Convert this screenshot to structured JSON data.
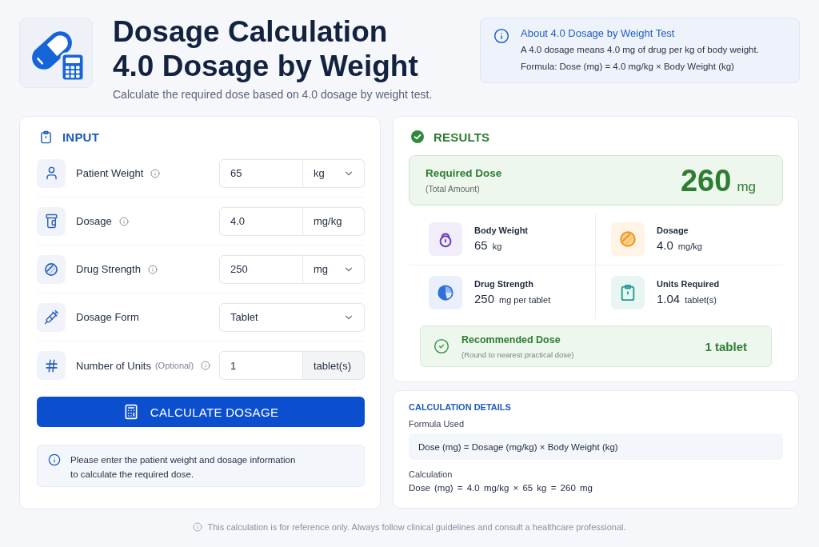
{
  "header": {
    "title_lines": [
      "Dosage Calculation",
      "4.0 Dosage by Weight"
    ],
    "subtitle": "Calculate the required dose based on 4.0 dosage by weight test."
  },
  "about": {
    "title": "About 4.0 Dosage by Weight Test",
    "lines": [
      "A 4.0 dosage means 4.0 mg of drug per kg of body weight.",
      "Formula: Dose (mg) = 4.0 mg/kg × Body Weight (kg)"
    ]
  },
  "input_panel": {
    "title": "INPUT",
    "fields": [
      {
        "label": "Patient Weight",
        "info": true,
        "kind": "number_unit",
        "value": "65",
        "unit": "kg",
        "unit_menu": true
      },
      {
        "label": "Dosage",
        "info": true,
        "kind": "number_unit",
        "value": "4.0",
        "unit": "mg/kg",
        "unit_menu": false
      },
      {
        "label": "Drug Strength",
        "info": true,
        "kind": "number_unit",
        "value": "250",
        "unit": "mg",
        "unit_menu": true
      },
      {
        "label": "Dosage Form",
        "info": false,
        "kind": "select",
        "value": "Tablet"
      },
      {
        "label": "Number of Units",
        "note": "(Optional)",
        "info": true,
        "kind": "number_addon",
        "value": "1",
        "unit": "tablet(s)"
      }
    ],
    "button": "CALCULATE DOSAGE",
    "hint": "Please enter the patient weight and dosage information to calculate the required dose."
  },
  "results": {
    "title": "RESULTS",
    "required": {
      "label": "Required Dose",
      "sublabel": "(Total Amount)",
      "value": "260",
      "unit": "mg"
    },
    "stats": [
      {
        "label": "Body Weight",
        "value": "65",
        "unit": "kg"
      },
      {
        "label": "Dosage",
        "value": "4.0",
        "unit": "mg/kg"
      },
      {
        "label": "Drug Strength",
        "value": "250",
        "unit": "mg per tablet"
      },
      {
        "label": "Units Required",
        "value": "1.04",
        "unit": "tablet(s)"
      }
    ],
    "recommended": {
      "label": "Recommended Dose",
      "note": "(Round to nearest practical dose)",
      "value": "1 tablet"
    }
  },
  "details": {
    "title": "CALCULATION DETAILS",
    "formula_label": "Formula Used",
    "formula": "Dose (mg) = Dosage (mg/kg) × Body Weight (kg)",
    "calculation_label": "Calculation",
    "calculation": "Dose (mg) = 4.0 mg/kg × 65 kg = 260 mg"
  },
  "footer": "This calculation is for reference only. Always follow clinical guidelines and consult a healthcare professional."
}
